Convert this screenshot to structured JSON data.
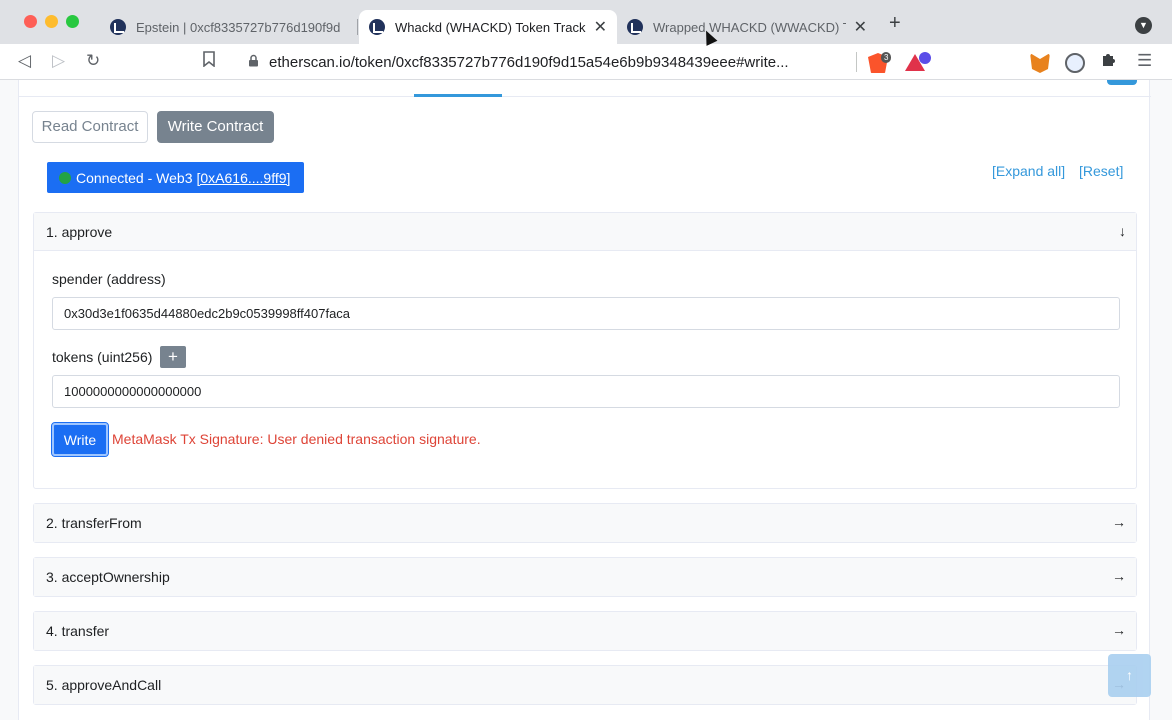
{
  "browser": {
    "tabs": [
      {
        "title": "Epstein | 0xcf8335727b776d190f9d"
      },
      {
        "title": "Whackd (WHACKD) Token Tracker"
      },
      {
        "title": "Wrapped WHACKD (WWACKD) Token"
      }
    ],
    "tab_close_glyph": "✕",
    "new_tab_glyph": "+",
    "tab_menu_glyph": "▼",
    "url": "etherscan.io/token/0xcf8335727b776d190f9d15a54e6b9b9348439eee#write...",
    "brave_badge": "3"
  },
  "page": {
    "read_contract_label": "Read Contract",
    "write_contract_label": "Write Contract",
    "connected_prefix": "Connected - Web3",
    "connected_address": "[0xA616....9ff9]",
    "expand_all": "[Expand all]",
    "reset": "[Reset]",
    "functions": [
      {
        "title": "1. approve",
        "arrow": "↓"
      },
      {
        "title": "2. transferFrom",
        "arrow": "→"
      },
      {
        "title": "3. acceptOwnership",
        "arrow": "→"
      },
      {
        "title": "4. transfer",
        "arrow": "→"
      },
      {
        "title": "5. approveAndCall",
        "arrow": "→"
      }
    ],
    "approve": {
      "spender_label": "spender (address)",
      "spender_value": "0x30d3e1f0635d44880edc2b9c0539998ff407faca",
      "tokens_label": "tokens (uint256)",
      "tokens_plus": "+",
      "tokens_value": "1000000000000000000",
      "write_label": "Write",
      "error_message": "MetaMask Tx Signature: User denied transaction signature."
    },
    "scroll_top_glyph": "↑"
  },
  "colors": {
    "accent_blue": "#1b6ef3",
    "link_blue": "#3498db",
    "error_red": "#de4437",
    "muted_gray": "#77838f"
  }
}
